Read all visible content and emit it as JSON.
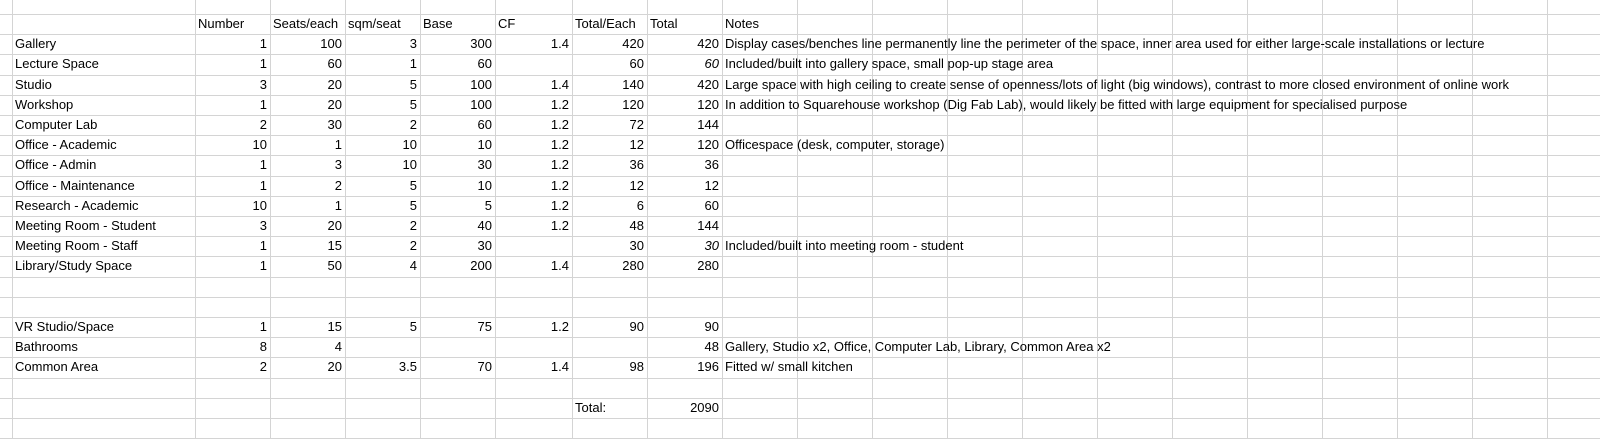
{
  "headers": {
    "number": "Number",
    "seats": "Seats/each",
    "sqm": "sqm/seat",
    "base": "Base",
    "cf": "CF",
    "total_each": "Total/Each",
    "total": "Total",
    "notes": "Notes"
  },
  "rows": [
    {
      "name": "Gallery",
      "number": "1",
      "seats": "100",
      "sqm": "3",
      "base": "300",
      "cf": "1.4",
      "total_each": "420",
      "total": "420",
      "total_italic": false,
      "notes": "Display cases/benches line permanently line the perimeter of the space, inner area used for either large-scale installations or lecture"
    },
    {
      "name": "Lecture Space",
      "number": "1",
      "seats": "60",
      "sqm": "1",
      "base": "60",
      "cf": "",
      "total_each": "60",
      "total": "60",
      "total_italic": true,
      "notes": "Included/built into gallery space, small pop-up stage area"
    },
    {
      "name": "Studio",
      "number": "3",
      "seats": "20",
      "sqm": "5",
      "base": "100",
      "cf": "1.4",
      "total_each": "140",
      "total": "420",
      "total_italic": false,
      "notes": "Large space with high ceiling to create sense of openness/lots of light (big windows), contrast to more closed environment of online work"
    },
    {
      "name": "Workshop",
      "number": "1",
      "seats": "20",
      "sqm": "5",
      "base": "100",
      "cf": "1.2",
      "total_each": "120",
      "total": "120",
      "total_italic": false,
      "notes": "In addition to Squarehouse workshop (Dig Fab Lab), would likely be fitted with large equipment for specialised purpose"
    },
    {
      "name": "Computer Lab",
      "number": "2",
      "seats": "30",
      "sqm": "2",
      "base": "60",
      "cf": "1.2",
      "total_each": "72",
      "total": "144",
      "total_italic": false,
      "notes": ""
    },
    {
      "name": "Office - Academic",
      "number": "10",
      "seats": "1",
      "sqm": "10",
      "base": "10",
      "cf": "1.2",
      "total_each": "12",
      "total": "120",
      "total_italic": false,
      "notes": "Officespace (desk, computer, storage)"
    },
    {
      "name": "Office - Admin",
      "number": "1",
      "seats": "3",
      "sqm": "10",
      "base": "30",
      "cf": "1.2",
      "total_each": "36",
      "total": "36",
      "total_italic": false,
      "notes": ""
    },
    {
      "name": "Office - Maintenance",
      "number": "1",
      "seats": "2",
      "sqm": "5",
      "base": "10",
      "cf": "1.2",
      "total_each": "12",
      "total": "12",
      "total_italic": false,
      "notes": ""
    },
    {
      "name": "Research - Academic",
      "number": "10",
      "seats": "1",
      "sqm": "5",
      "base": "5",
      "cf": "1.2",
      "total_each": "6",
      "total": "60",
      "total_italic": false,
      "notes": ""
    },
    {
      "name": "Meeting Room - Student",
      "number": "3",
      "seats": "20",
      "sqm": "2",
      "base": "40",
      "cf": "1.2",
      "total_each": "48",
      "total": "144",
      "total_italic": false,
      "notes": ""
    },
    {
      "name": "Meeting Room - Staff",
      "number": "1",
      "seats": "15",
      "sqm": "2",
      "base": "30",
      "cf": "",
      "total_each": "30",
      "total": "30",
      "total_italic": true,
      "notes": "Included/built into meeting room - student"
    },
    {
      "name": "Library/Study Space",
      "number": "1",
      "seats": "50",
      "sqm": "4",
      "base": "200",
      "cf": "1.4",
      "total_each": "280",
      "total": "280",
      "total_italic": false,
      "notes": ""
    },
    {
      "name": "",
      "number": "",
      "seats": "",
      "sqm": "",
      "base": "",
      "cf": "",
      "total_each": "",
      "total": "",
      "total_italic": false,
      "notes": ""
    },
    {
      "name": "",
      "number": "",
      "seats": "",
      "sqm": "",
      "base": "",
      "cf": "",
      "total_each": "",
      "total": "",
      "total_italic": false,
      "notes": ""
    },
    {
      "name": "VR Studio/Space",
      "number": "1",
      "seats": "15",
      "sqm": "5",
      "base": "75",
      "cf": "1.2",
      "total_each": "90",
      "total": "90",
      "total_italic": false,
      "notes": ""
    },
    {
      "name": "Bathrooms",
      "number": "8",
      "seats": "4",
      "sqm": "",
      "base": "",
      "cf": "",
      "total_each": "",
      "total": "48",
      "total_italic": false,
      "notes": "Gallery, Studio x2, Office, Computer Lab, Library, Common Area x2"
    },
    {
      "name": "Common Area",
      "number": "2",
      "seats": "20",
      "sqm": "3.5",
      "base": "70",
      "cf": "1.4",
      "total_each": "98",
      "total": "196",
      "total_italic": false,
      "notes": "Fitted w/ small kitchen"
    }
  ],
  "summary": {
    "label": "Total:",
    "value": "2090"
  },
  "colors": {
    "gridline": "#d4d4d4",
    "text": "#000000",
    "background": "#ffffff"
  }
}
